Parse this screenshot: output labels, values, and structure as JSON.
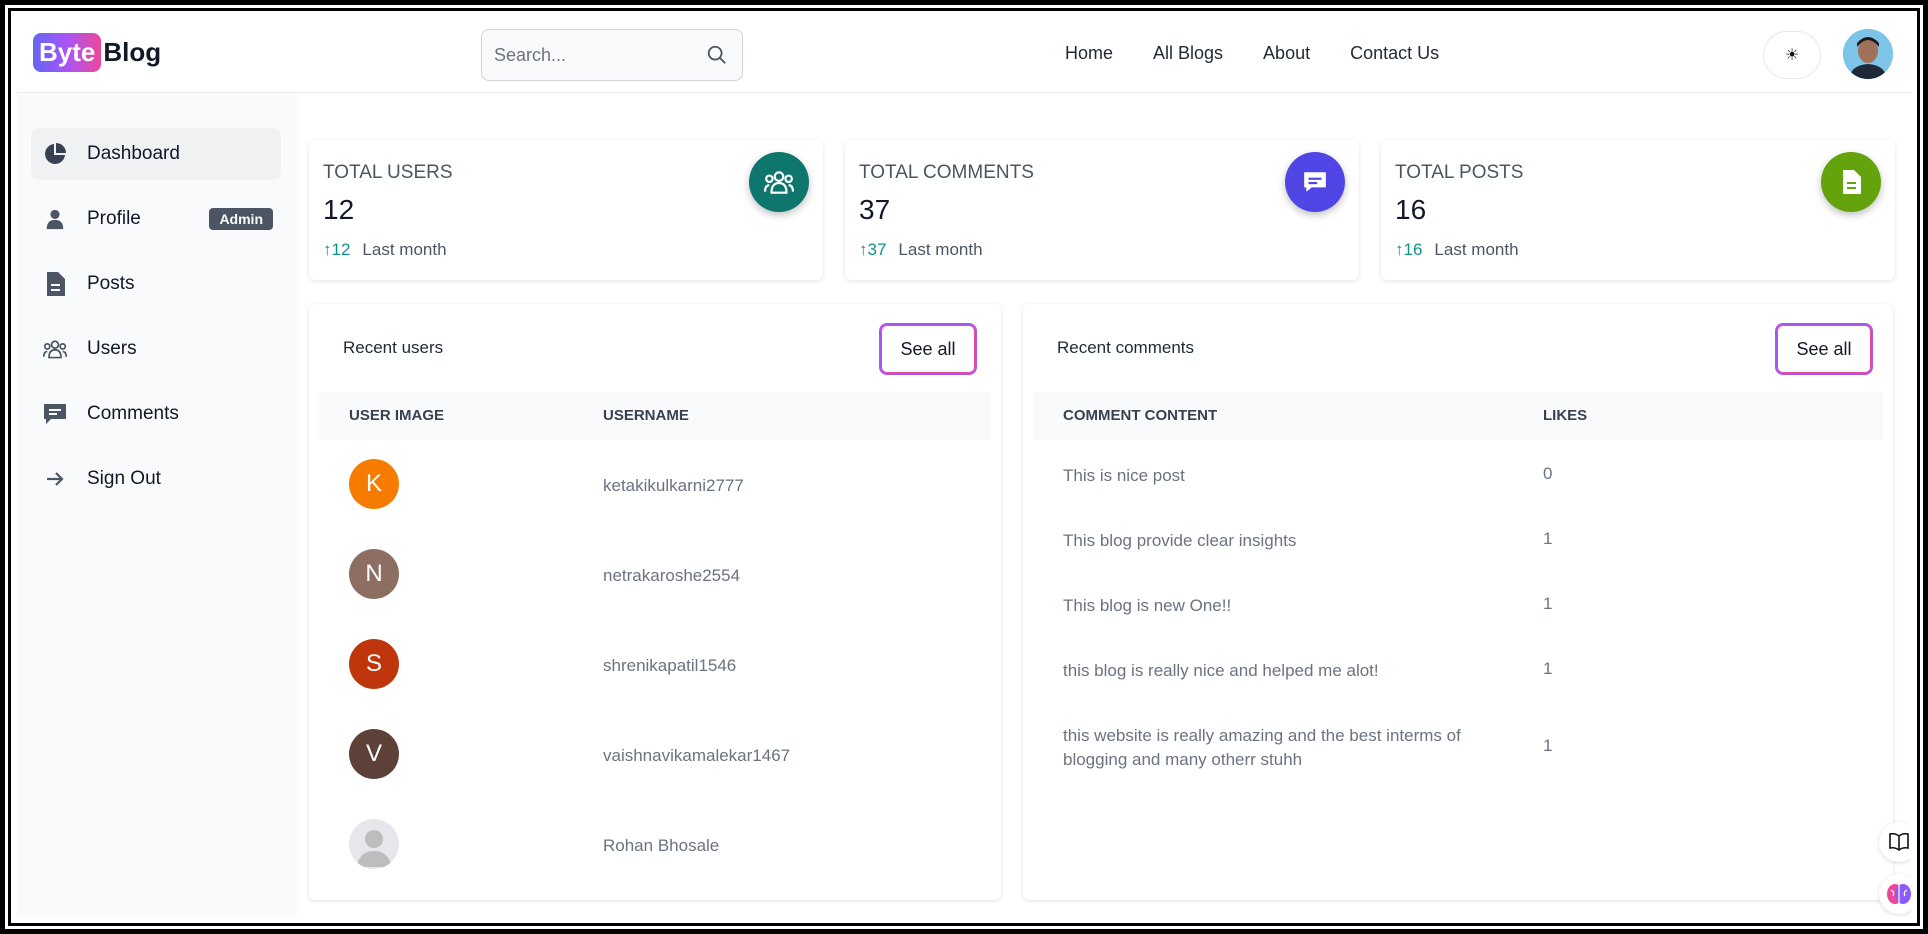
{
  "header": {
    "logo_badge": "Byte",
    "logo_text": "Blog",
    "search_placeholder": "Search...",
    "nav": [
      "Home",
      "All Blogs",
      "About",
      "Contact Us"
    ],
    "theme_icon": "sun-icon"
  },
  "sidebar": {
    "items": [
      {
        "label": "Dashboard",
        "icon": "pie-chart-icon"
      },
      {
        "label": "Profile",
        "icon": "user-icon",
        "badge": "Admin"
      },
      {
        "label": "Posts",
        "icon": "document-icon"
      },
      {
        "label": "Users",
        "icon": "users-icon"
      },
      {
        "label": "Comments",
        "icon": "comment-icon"
      },
      {
        "label": "Sign Out",
        "icon": "arrow-right-icon"
      }
    ]
  },
  "stats": [
    {
      "label": "TOTAL USERS",
      "value": "12",
      "delta": "12",
      "period": "Last month",
      "color": "#0f766e"
    },
    {
      "label": "TOTAL COMMENTS",
      "value": "37",
      "delta": "37",
      "period": "Last month",
      "color": "#4f46e5"
    },
    {
      "label": "TOTAL POSTS",
      "value": "16",
      "delta": "16",
      "period": "Last month",
      "color": "#65a30d"
    }
  ],
  "recent_users": {
    "title": "Recent users",
    "see_all": "See all",
    "columns": [
      "USER IMAGE",
      "USERNAME"
    ],
    "rows": [
      {
        "initial": "K",
        "username": "ketakikulkarni2777",
        "color": "#f57c00"
      },
      {
        "initial": "N",
        "username": "netrakaroshe2554",
        "color": "#8d6e63"
      },
      {
        "initial": "S",
        "username": "shrenikapatil1546",
        "color": "#bf360c"
      },
      {
        "initial": "V",
        "username": "vaishnavikamalekar1467",
        "color": "#5d4037"
      },
      {
        "initial": "",
        "username": "Rohan Bhosale",
        "color": "#e5e7eb"
      }
    ]
  },
  "recent_comments": {
    "title": "Recent comments",
    "see_all": "See all",
    "columns": [
      "COMMENT CONTENT",
      "LIKES"
    ],
    "rows": [
      {
        "content": "This is nice post",
        "likes": "0"
      },
      {
        "content": "This blog provide clear insights",
        "likes": "1"
      },
      {
        "content": "This blog is new One!!",
        "likes": "1"
      },
      {
        "content": "this blog is really nice and helped me alot!",
        "likes": "1"
      },
      {
        "content": "this website is really amazing and the best interms of blogging and many otherr stuhh",
        "likes": "1"
      }
    ]
  }
}
